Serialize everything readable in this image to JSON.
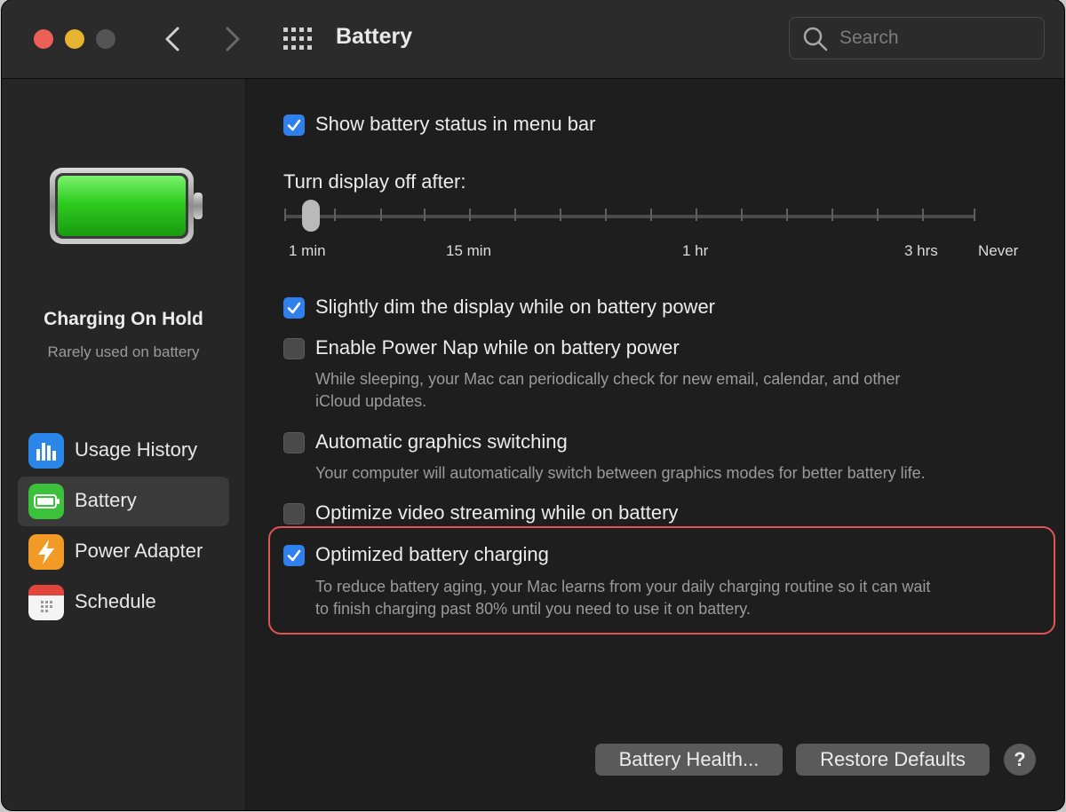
{
  "window": {
    "title": "Battery"
  },
  "search": {
    "placeholder": "Search"
  },
  "sidebar": {
    "status_title": "Charging On Hold",
    "status_sub": "Rarely used on battery",
    "items": [
      {
        "label": "Usage History",
        "icon": "bar-chart-icon",
        "selected": false
      },
      {
        "label": "Battery",
        "icon": "battery-icon",
        "selected": true
      },
      {
        "label": "Power Adapter",
        "icon": "lightning-icon",
        "selected": false
      },
      {
        "label": "Schedule",
        "icon": "calendar-icon",
        "selected": false
      }
    ]
  },
  "options": {
    "show_status": {
      "label": "Show battery status in menu bar",
      "checked": true
    },
    "dim_display": {
      "label": "Slightly dim the display while on battery power",
      "checked": true
    },
    "power_nap": {
      "label": "Enable Power Nap while on battery power",
      "checked": false,
      "desc_line1": "While sleeping, your Mac can periodically check for new email, calendar, and other",
      "desc_line2": "iCloud updates."
    },
    "gfx_switching": {
      "label": "Automatic graphics switching",
      "checked": false,
      "desc": "Your computer will automatically switch between graphics modes for better battery life."
    },
    "video_streaming": {
      "label": "Optimize video streaming while on battery",
      "checked": false
    },
    "optimized_charging": {
      "label": "Optimized battery charging",
      "checked": true,
      "desc_line1": "To reduce battery aging, your Mac learns from your daily charging routine so it can wait",
      "desc_line2": "to finish charging past 80% until you need to use it on battery."
    }
  },
  "display_off": {
    "title": "Turn display off after:",
    "value": "1 min",
    "ticks": [
      "1 min",
      "15 min",
      "1 hr",
      "3 hrs",
      "Never"
    ]
  },
  "buttons": {
    "battery_health": "Battery Health...",
    "restore_defaults": "Restore Defaults",
    "help": "?"
  },
  "colors": {
    "accent": "#2f80ed",
    "highlight_border": "#e05454",
    "battery_fill": "#34c72a"
  }
}
